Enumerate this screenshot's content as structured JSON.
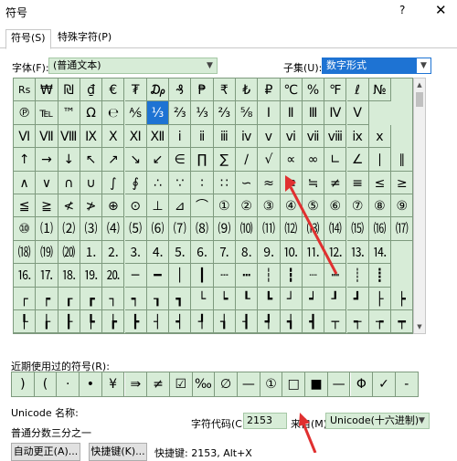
{
  "window": {
    "title": "符号",
    "help_glyph": "?",
    "close_glyph": "✕"
  },
  "tabs": [
    {
      "label": "符号(S)"
    },
    {
      "label": "特殊字符(P)"
    }
  ],
  "font": {
    "label": "字体(F):",
    "value": "(普通文本)"
  },
  "subset": {
    "label": "子集(U):",
    "value": "数字形式"
  },
  "grid_rows": [
    [
      "Rs",
      "₩",
      "₪",
      "₫",
      "€",
      "₮",
      "₯",
      "₰",
      "₱",
      "₹",
      "₺",
      "₽",
      "℃",
      "%",
      "℉",
      "ℓ",
      "№"
    ],
    [
      "℗",
      "℡",
      "™",
      "Ω",
      "℮",
      "⅍",
      "⅓",
      "⅔",
      "⅓",
      "⅔",
      "⅝",
      "Ⅰ",
      "Ⅱ",
      "Ⅲ",
      "Ⅳ",
      "Ⅴ"
    ],
    [
      "Ⅵ",
      "Ⅶ",
      "Ⅷ",
      "Ⅸ",
      "Ⅹ",
      "Ⅺ",
      "Ⅻ",
      "ⅰ",
      "ⅱ",
      "ⅲ",
      "ⅳ",
      "ⅴ",
      "ⅵ",
      "ⅶ",
      "ⅷ",
      "ⅸ",
      "ⅹ"
    ],
    [
      "↑",
      "→",
      "↓",
      "↖",
      "↗",
      "↘",
      "↙",
      "∈",
      "∏",
      "∑",
      "∕",
      "√",
      "∝",
      "∞",
      "∟",
      "∠",
      "∣",
      "∥"
    ],
    [
      "∧",
      "∨",
      "∩",
      "∪",
      "∫",
      "∮",
      "∴",
      "∵",
      "∶",
      "∷",
      "∽",
      "≈",
      "≌",
      "≒",
      "≠",
      "≡",
      "≤",
      "≥"
    ],
    [
      "≦",
      "≧",
      "≮",
      "≯",
      "⊕",
      "⊙",
      "⊥",
      "⊿",
      "⌒",
      "①",
      "②",
      "③",
      "④",
      "⑤",
      "⑥",
      "⑦",
      "⑧",
      "⑨"
    ],
    [
      "⑩",
      "⑴",
      "⑵",
      "⑶",
      "⑷",
      "⑸",
      "⑹",
      "⑺",
      "⑻",
      "⑼",
      "⑽",
      "⑾",
      "⑿",
      "⒀",
      "⒁",
      "⒂",
      "⒃",
      "⒄"
    ],
    [
      "⒅",
      "⒆",
      "⒇",
      "⒈",
      "⒉",
      "⒊",
      "⒋",
      "⒌",
      "⒍",
      "⒎",
      "⒏",
      "⒐",
      "⒑",
      "⒒",
      "⒓",
      "⒔",
      "⒕"
    ],
    [
      "⒗",
      "⒘",
      "⒙",
      "⒚",
      "⒛",
      "─",
      "━",
      "│",
      "┃",
      "┄",
      "┅",
      "┆",
      "┇",
      "┈",
      "┉",
      "┊",
      "┋"
    ],
    [
      "┌",
      "┍",
      "┎",
      "┏",
      "┐",
      "┑",
      "┒",
      "┓",
      "└",
      "┕",
      "┖",
      "┗",
      "┘",
      "┙",
      "┚",
      "┛",
      "├",
      "┝"
    ],
    [
      "┞",
      "┟",
      "┠",
      "┡",
      "┢",
      "┣",
      "┤",
      "┥",
      "┦",
      "┧",
      "┨",
      "┩",
      "┪",
      "┫",
      "┬",
      "┭",
      "┮",
      "┯"
    ]
  ],
  "selected": {
    "row": 1,
    "col": 6
  },
  "recent": {
    "label": "近期使用过的符号(R):",
    "items": [
      ")",
      "(",
      "·",
      "•",
      "¥",
      "⇛",
      "≠",
      "☑",
      "‰",
      "∅",
      "—",
      "①",
      "□",
      "■",
      "—",
      "Φ",
      "✓",
      "-"
    ]
  },
  "unicode": {
    "label": "Unicode 名称:",
    "description": "普通分数三分之一"
  },
  "char_code": {
    "label": "字符代码(C):",
    "value": "2153"
  },
  "from": {
    "label": "来自(M):",
    "value": "Unicode(十六进制)"
  },
  "buttons": {
    "autocorrect": "自动更正(A)...",
    "shortcut_key": "快捷键(K)..."
  },
  "shortcut_info": "快捷键: 2153, Alt+X",
  "colors": {
    "cell_bg": "#d7ecd7",
    "grid_line": "#7e9a7e",
    "selection": "#1e73d3",
    "arrow": "#e03030"
  }
}
